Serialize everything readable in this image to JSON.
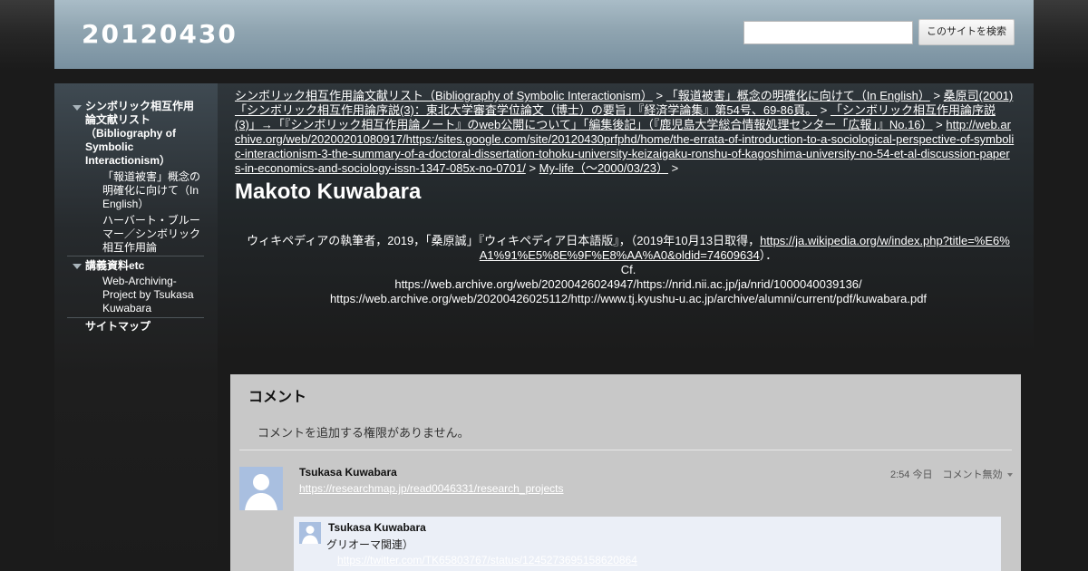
{
  "header": {
    "site_title": "20120430",
    "search_placeholder": "",
    "search_button_label": "このサイトを検索"
  },
  "sidebar": {
    "items": [
      {
        "label": "シンボリック相互作用論文献リスト（Bibliography of Symbolic Interactionism）",
        "expanded": true
      },
      {
        "label": "「報道被害」概念の明確化に向けて（In English）"
      },
      {
        "label": "ハーバート・ブルーマー／シンボリック相互作用論"
      },
      {
        "label": "講義資料etc",
        "expanded": true
      },
      {
        "label": "Web-Archiving-Project by Tsukasa Kuwabara"
      },
      {
        "label": "サイトマップ"
      }
    ]
  },
  "breadcrumb": {
    "items": [
      "シンボリック相互作用論文献リスト（Bibliography of Symbolic Interactionism）",
      "「報道被害」概念の明確化に向けて（In English）",
      "桑原司(2001)「シンボリック相互作用論序説(3)：東北大学審査学位論文（博士）の要旨」『経済学論集』第54号、69-86頁。",
      "「シンボリック相互作用論序説(3)」→「『シンボリック相互作用論ノート』のweb公開について」「編集後記」（『鹿児島大学総合情報処理センター「広報」』No.16）",
      "http://web.archive.org/web/20200201080917/https:/sites.google.com/site/20120430prfphd/home/the-errata-of-introduction-to-a-sociological-perspective-of-symbolic-interactionism-3-the-summary-of-a-doctoral-dissertation-tohoku-university-keizaigaku-ronshu-of-kagoshima-university-no-54-et-al-discussion-papers-in-economics-and-sociology-issn-1347-085x-no-0701/",
      "My-life（～2000/03/23）"
    ],
    "separator": ">"
  },
  "page_title": "Makoto Kuwabara",
  "body": {
    "line1_prefix": "ウィキペディアの執筆者，2019，「桑原誠」『ウィキペディア日本語版』，（2019年10月13日取得，",
    "line1_link": "https://ja.wikipedia.org/w/index.php?title=%E6%A1%91%E5%8E%9F%E8%AA%A0&oldid=74609634",
    "line1_suffix": "）．",
    "line2": "Cf.",
    "line3": "https://web.archive.org/web/20200426024947/https://nrid.nii.ac.jp/ja/nrid/1000040039136/",
    "line4": "https://web.archive.org/web/20200426025112/http://www.tj.kyushu-u.ac.jp/archive/alumni/current/pdf/kuwabara.pdf"
  },
  "comments": {
    "heading": "コメント",
    "no_permission": "コメントを追加する権限がありません。",
    "items": [
      {
        "author": "Tsukasa Kuwabara",
        "link": "https://researchmap.jp/read0046331/research_projects",
        "time": "2:54 今日",
        "action": "コメント無効"
      }
    ],
    "reply": {
      "author": "Tsukasa Kuwabara",
      "text": "グリオーマ関連）",
      "link": "https://twitter.com/TK65803767/status/1245273695158620864"
    }
  },
  "colors": {
    "header_bg": "#8fa4b0",
    "page_bg": "#1b1b1b",
    "comments_bg": "#c8c8c8",
    "reply_bg": "#ebeff7",
    "avatar": "#a9bfe0"
  }
}
